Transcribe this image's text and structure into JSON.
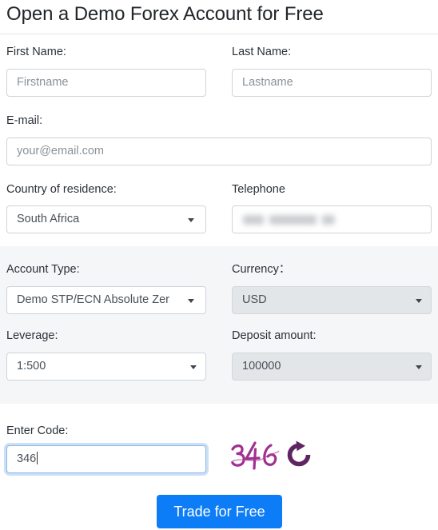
{
  "form": {
    "title": "Open a Demo Forex Account for Free",
    "fields": {
      "first_name": {
        "label": "First Name:",
        "placeholder": "Firstname",
        "value": ""
      },
      "last_name": {
        "label": "Last Name:",
        "placeholder": "Lastname",
        "value": ""
      },
      "email": {
        "label": "E-mail:",
        "placeholder": "your@email.com",
        "value": ""
      },
      "country": {
        "label": "Country of residence:",
        "selected": "South Africa"
      },
      "telephone": {
        "label": "Telephone",
        "placeholder": "",
        "value": ""
      },
      "account_type": {
        "label": "Account Type:",
        "selected": "Demo STP/ECN Absolute Zer"
      },
      "currency": {
        "label": "Currency：",
        "selected": "USD"
      },
      "leverage": {
        "label": "Leverage:",
        "selected": "1:500"
      },
      "deposit": {
        "label": "Deposit amount:",
        "selected": "100000"
      },
      "code": {
        "label": "Enter Code:",
        "value": "346"
      }
    },
    "captcha": {
      "text": "346",
      "refresh_title": "Refresh code"
    },
    "submit_label": "Trade for Free"
  },
  "colors": {
    "accent_blue": "#0d7df7",
    "panel_grey": "#f5f6f8",
    "captcha_purple": "#a03090",
    "refresh_purple": "#5f2463",
    "border_grey": "#ced4da",
    "focus_ring": "#8fb9e8"
  }
}
